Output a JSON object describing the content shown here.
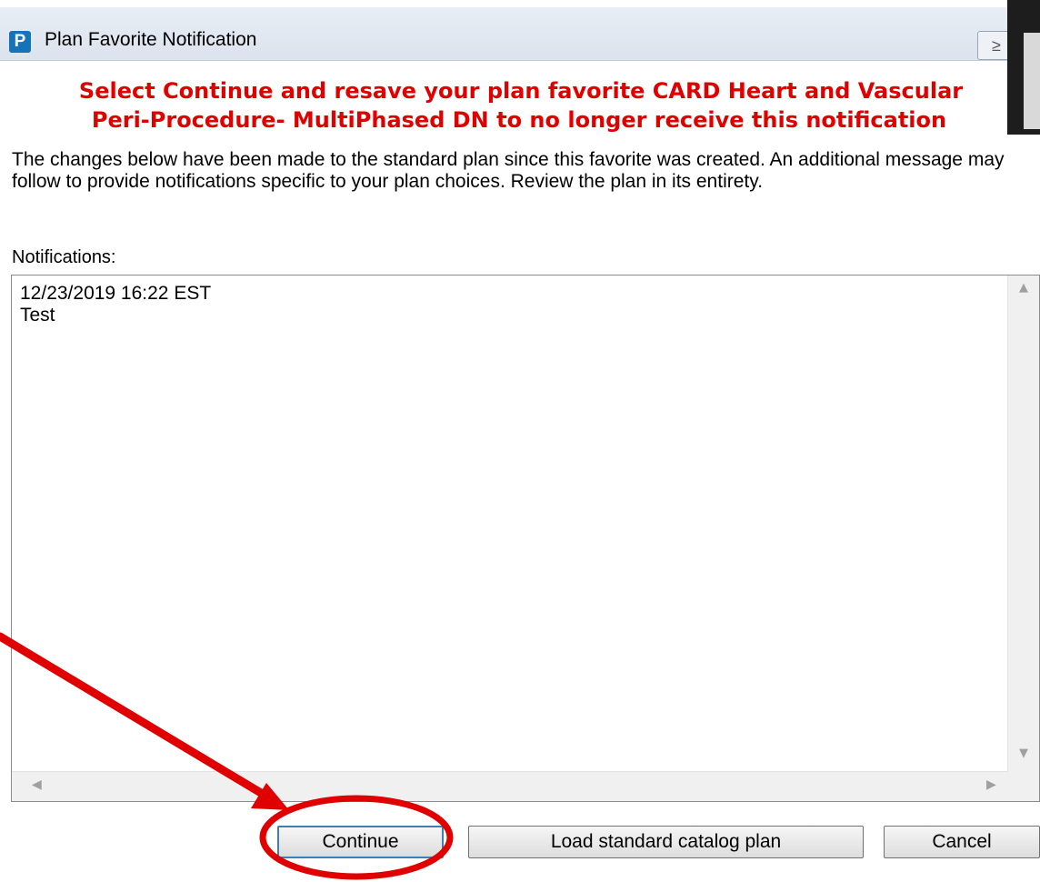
{
  "window": {
    "icon_letter": "P",
    "title": "Plan Favorite Notification",
    "titlebar_button_glyph": "≥"
  },
  "header": {
    "line1": "Select Continue and resave your plan favorite CARD Heart and Vascular",
    "line2": "Peri-Procedure- MultiPhased DN to no longer receive this notification",
    "color": "#e10000"
  },
  "description": "The changes below have been made to the standard plan since this favorite was created. An additional message may follow to provide notifications specific to your plan choices. Review the plan in its entirety.",
  "notifications": {
    "label": "Notifications:",
    "entries": [
      {
        "timestamp": "12/23/2019 16:22 EST",
        "text": "Test"
      }
    ]
  },
  "scrollbars": {
    "up_arrow": "▲",
    "down_arrow": "▼",
    "left_arrow": "◀",
    "right_arrow": "▶"
  },
  "buttons": {
    "continue": "Continue",
    "load_standard": "Load standard catalog plan",
    "cancel": "Cancel"
  },
  "annotation": {
    "color": "#e00000",
    "shapes": [
      "arrow",
      "ellipse"
    ],
    "target": "Continue"
  }
}
